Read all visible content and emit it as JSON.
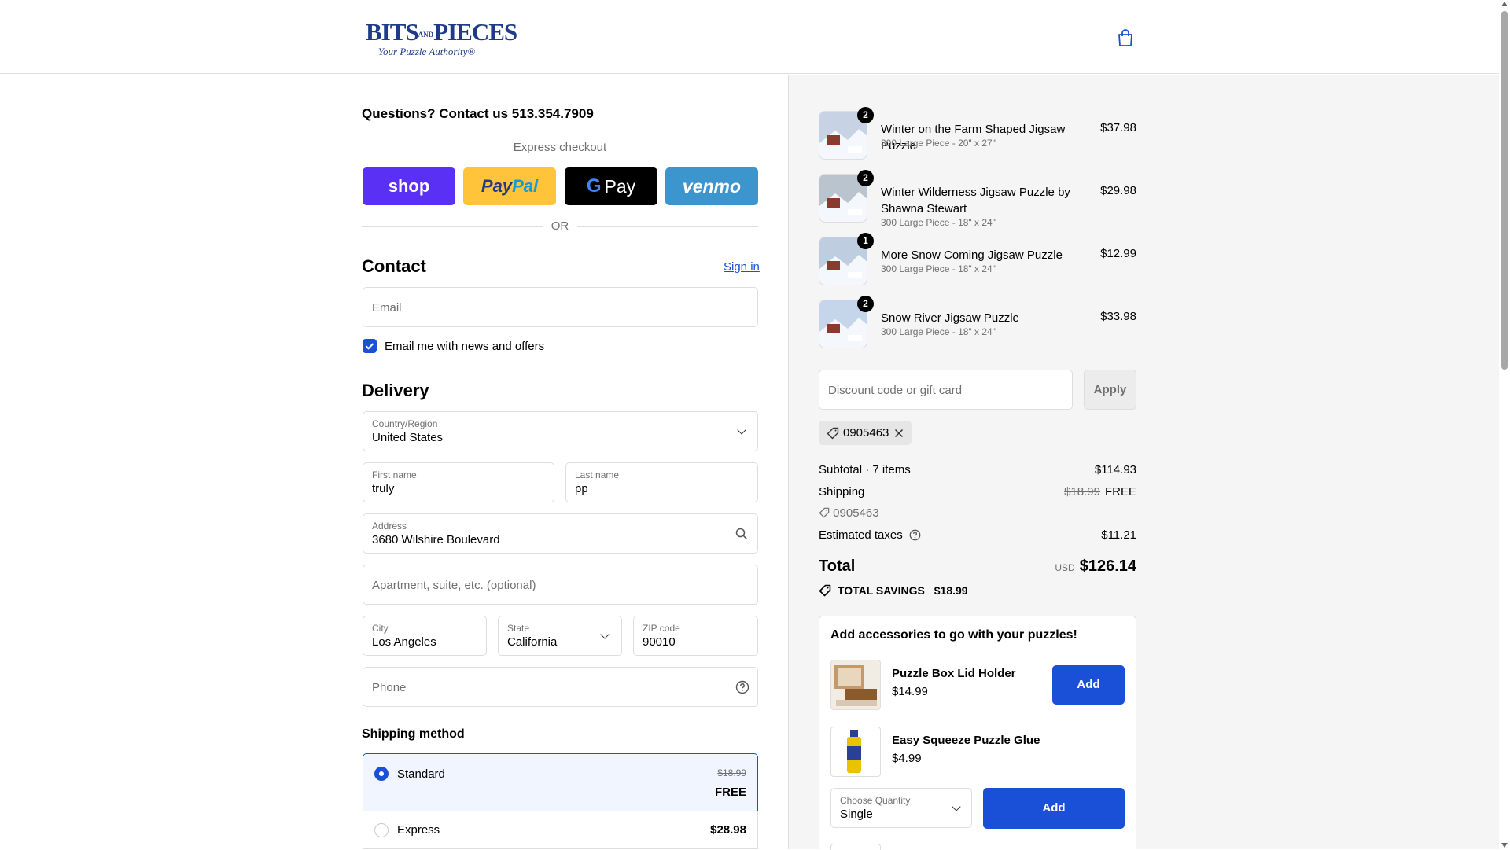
{
  "header": {
    "logo_line1_a": "BITS",
    "logo_line1_amp": "AND",
    "logo_line1_b": "PIECES",
    "logo_line2": "Your Puzzle Authority",
    "cart_icon": "shopping-bag-icon"
  },
  "left": {
    "questions": "Questions? Contact us 513.354.7909",
    "express_title": "Express checkout",
    "pay_buttons": {
      "shop": "shop",
      "paypal_a": "Pay",
      "paypal_b": "Pal",
      "gpay": "Pay",
      "venmo": "venmo"
    },
    "or": "OR",
    "contact": {
      "title": "Contact",
      "sign_in": "Sign in",
      "email_placeholder": "Email",
      "news_label": "Email me with news and offers",
      "news_checked": true
    },
    "delivery": {
      "title": "Delivery",
      "country_label": "Country/Region",
      "country_value": "United States",
      "first_label": "First name",
      "first_value": "truly",
      "last_label": "Last name",
      "last_value": "pp",
      "address_label": "Address",
      "address_value": "3680 Wilshire Boulevard",
      "apt_placeholder": "Apartment, suite, etc. (optional)",
      "city_label": "City",
      "city_value": "Los Angeles",
      "state_label": "State",
      "state_value": "California",
      "zip_label": "ZIP code",
      "zip_value": "90010",
      "phone_placeholder": "Phone"
    },
    "shipping": {
      "title": "Shipping method",
      "standard_label": "Standard",
      "standard_old": "$18.99",
      "standard_price": "FREE",
      "express_label": "Express",
      "express_price": "$28.98"
    }
  },
  "right": {
    "items": [
      {
        "qty": "2",
        "name": "Winter on the Farm Shaped Jigsaw Puzzle",
        "variant": "300 Large Piece - 20\" x 27\"",
        "price": "$37.98"
      },
      {
        "qty": "2",
        "name": "Winter Wilderness Jigsaw Puzzle by Shawna Stewart",
        "variant": "300 Large Piece - 18\" x 24\"",
        "price": "$29.98"
      },
      {
        "qty": "1",
        "name": "More Snow Coming Jigsaw Puzzle",
        "variant": "300 Large Piece - 18\" x 24\"",
        "price": "$12.99"
      },
      {
        "qty": "2",
        "name": "Snow River Jigsaw Puzzle",
        "variant": "300 Large Piece - 18\" x 24\"",
        "price": "$33.98"
      }
    ],
    "discount_placeholder": "Discount code or gift card",
    "apply": "Apply",
    "applied_code": "0905463",
    "subtotal_label": "Subtotal · 7 items",
    "subtotal_value": "$114.93",
    "shipping_label": "Shipping",
    "shipping_old": "$18.99",
    "shipping_value": "FREE",
    "shipping_code": "0905463",
    "taxes_label": "Estimated taxes",
    "taxes_value": "$11.21",
    "total_label": "Total",
    "total_currency": "USD",
    "total_value": "$126.14",
    "savings_label": "TOTAL SAVINGS",
    "savings_value": "$18.99",
    "accessories": {
      "title": "Add accessories to go with your puzzles!",
      "items": [
        {
          "name": "Puzzle Box Lid Holder",
          "price": "$14.99",
          "add": "Add"
        },
        {
          "name": "Easy Squeeze Puzzle Glue",
          "price": "$4.99",
          "add": "Add"
        }
      ],
      "qty_label": "Choose Quantity",
      "qty_value": "Single"
    }
  },
  "colors": {
    "accent": "#1a4fd8",
    "shop": "#5a31f4",
    "paypal": "#ffc439",
    "gpay": "#000000",
    "venmo": "#3d95ce",
    "logo": "#1d3b86"
  }
}
